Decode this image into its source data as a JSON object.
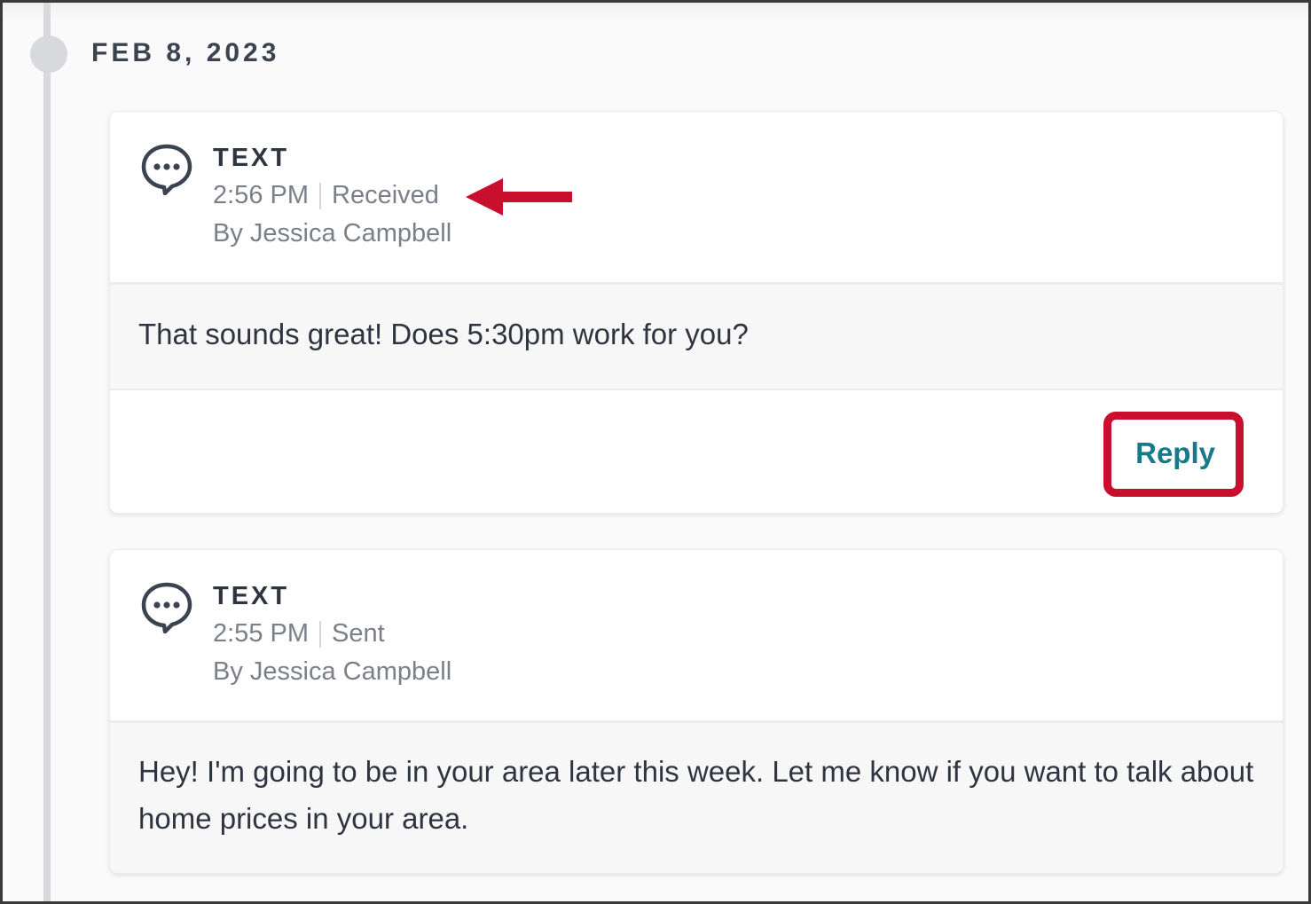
{
  "timeline": {
    "date": "FEB 8, 2023"
  },
  "messages": [
    {
      "type": "TEXT",
      "time": "2:56 PM",
      "status": "Received",
      "author": "By Jessica Campbell",
      "body": "That sounds great! Does 5:30pm work for you?",
      "reply_label": "Reply",
      "icon": "chat-bubble-icon"
    },
    {
      "type": "TEXT",
      "time": "2:55 PM",
      "status": "Sent",
      "author": "By Jessica Campbell",
      "body": "Hey! I'm going to be in your area later this week. Let me know if you want to talk about home prices in your area.",
      "icon": "chat-bubble-icon"
    }
  ],
  "annotations": {
    "arrow_target": "status",
    "highlight_target": "reply-button",
    "color": "#c8102e"
  },
  "colors": {
    "accent": "#177a8b",
    "timeline": "#d7d9dc",
    "text_dark": "#2e3440",
    "text_muted": "#7b7f87"
  }
}
